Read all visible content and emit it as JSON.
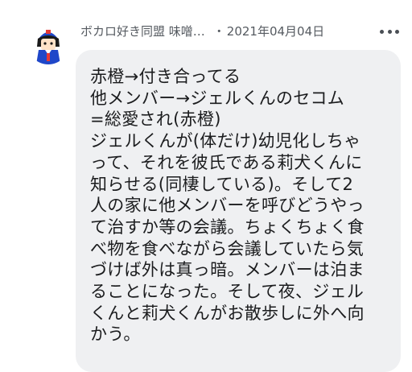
{
  "post": {
    "author": "ボカロ好き同盟 味噌…",
    "separator": "・",
    "date": "2021年04月04日",
    "more_icon": "more-horizontal-icon",
    "avatar_icon": "character-avatar",
    "bubble_text": "赤橙→付き合ってる\n他メンバー→ジェルくんのセコム\n=総愛され(赤橙)\nジェルくんが(体だけ)幼児化しちゃ\nって、それを彼氏である莉犬くんに\n知らせる(同棲している)。そして2\n人の家に他メンバーを呼びどうやっ\nて治すか等の会議。ちょくちょく食\nべ物を食べながら会議していたら気\nづけば外は真っ暗。メンバーは泊ま\nることになった。そして夜、ジェル\nくんと莉犬くんがお散歩しに外へ向\nかう。"
  },
  "colors": {
    "bubble_background": "#eff0f2",
    "text": "#1b1c1e",
    "meta_text": "#555a60"
  }
}
